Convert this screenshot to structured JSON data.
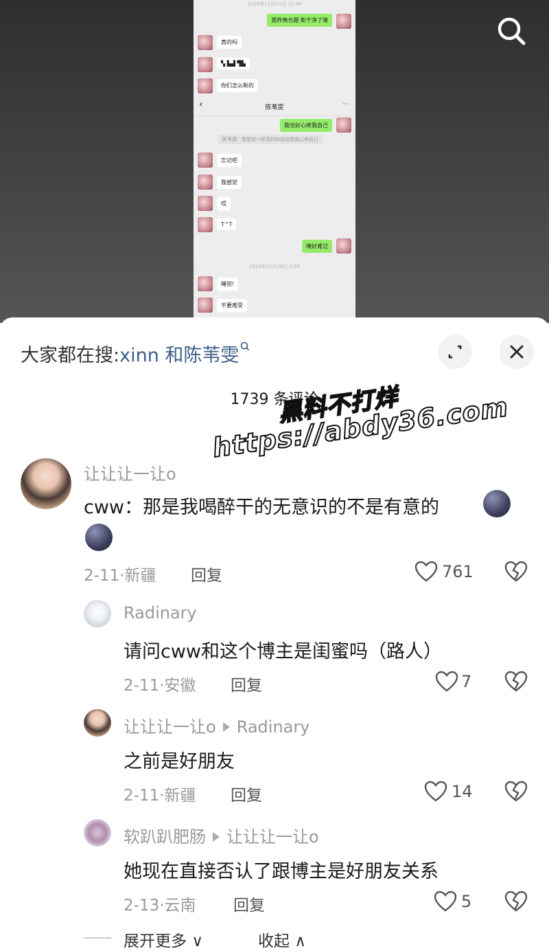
{
  "chat": {
    "ts1": "2026年12月24日 10:49",
    "ts2": "2026年12月26日 0:55",
    "title": "陈苇雯",
    "back": "‹",
    "more": "···",
    "messages": [
      {
        "side": "right",
        "text": "我昨晚也跟   断干净了噢"
      },
      {
        "side": "left",
        "text": "真的吗"
      },
      {
        "side": "left",
        "text": "▚ ▙▟ ▜▙"
      },
      {
        "side": "left",
        "text": "你们怎么断的"
      },
      {
        "side": "right",
        "text": "我也好心疼我自己"
      },
      {
        "side": "left",
        "text": "忘记吧"
      },
      {
        "side": "left",
        "text": "我感觉"
      },
      {
        "side": "left",
        "text": "哎"
      },
      {
        "side": "left",
        "text": "T^T"
      },
      {
        "side": "right",
        "text": "噢好难过"
      },
      {
        "side": "left",
        "text": "睡觉!"
      },
      {
        "side": "left",
        "text": "不要难受"
      }
    ],
    "system": "陈苇雯：我是说一样到的如油自我我心疼自己"
  },
  "panel": {
    "search_prefix": "大家都在搜:",
    "search_keyword": "xinn 和陈苇雯",
    "comment_count": "1739 条评论",
    "watermark1": "黑料不打烊",
    "watermark2": "https://abdy36.com"
  },
  "comments": [
    {
      "user": "让让让一让o",
      "reply_to": "",
      "text1": "cww：那是我喝醉干的无意识的不是有意的",
      "text2": "",
      "date": "2-11·新疆",
      "reply": "回复",
      "likes": "761"
    },
    {
      "user": "Radinary",
      "reply_to": "",
      "text1": "请问cww和这个博主是闺蜜吗（路人）",
      "date": "2-11·安徽",
      "reply": "回复",
      "likes": "7"
    },
    {
      "user": "让让让一让o",
      "reply_to": "Radinary",
      "text1": "之前是好朋友",
      "date": "2-11·新疆",
      "reply": "回复",
      "likes": "14"
    },
    {
      "user": "软趴趴肥肠",
      "reply_to": "让让让一让o",
      "text1": "她现在直接否认了跟博主是好朋友关系",
      "date": "2-13·云南",
      "reply": "回复",
      "likes": "5"
    }
  ],
  "footer": {
    "expand": "展开更多 ∨",
    "collapse": "收起 ∧"
  },
  "colors": {
    "keyword": "#3d5e8a",
    "bubble_green": "#95ec69",
    "chat_bg": "#ededed"
  },
  "icons": [
    "search-icon",
    "expand-icon",
    "close-icon",
    "heart-icon",
    "broken-heart-icon",
    "emoji-icon"
  ]
}
